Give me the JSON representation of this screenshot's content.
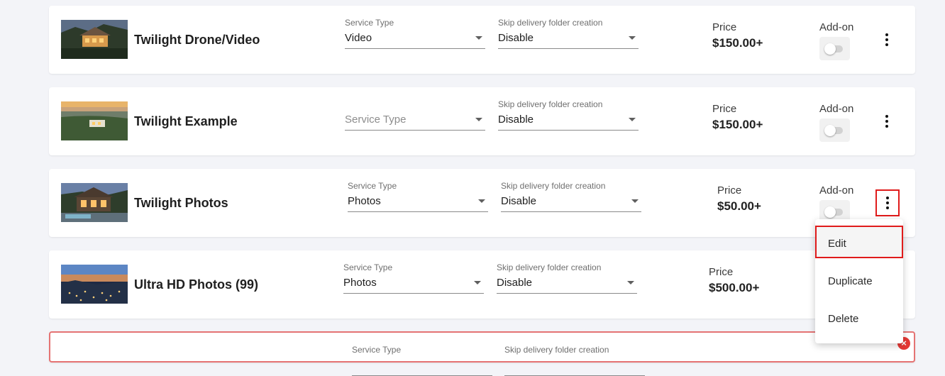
{
  "fields": {
    "service_type_label": "Service Type",
    "skip_label": "Skip delivery folder creation",
    "price_label": "Price",
    "addon_label": "Add-on"
  },
  "services": [
    {
      "name": "Twilight Drone/Video",
      "service_type": "Video",
      "skip_delivery": "Disable",
      "price": "$150.00+",
      "addon_enabled": false
    },
    {
      "name": "Twilight Example",
      "service_type": "",
      "service_type_placeholder": "Service Type",
      "skip_delivery": "Disable",
      "price": "$150.00+",
      "addon_enabled": false
    },
    {
      "name": "Twilight Photos",
      "service_type": "Photos",
      "skip_delivery": "Disable",
      "price": "$50.00+",
      "addon_enabled": false
    },
    {
      "name": "Ultra HD Photos (99)",
      "service_type": "Photos",
      "skip_delivery": "Disable",
      "price": "$500.00+"
    }
  ],
  "partial_card": {
    "service_type_label": "Service Type",
    "skip_label": "Skip delivery folder creation"
  },
  "menu": {
    "items": [
      "Edit",
      "Duplicate",
      "Delete"
    ],
    "active_item": "Edit"
  },
  "icons": {
    "more": "more-vertical-icon",
    "caret": "chevron-down-icon",
    "close": "close-icon"
  },
  "colors": {
    "highlight": "#e01b1b",
    "error_border": "#e57373",
    "background": "#f3f4f8"
  }
}
